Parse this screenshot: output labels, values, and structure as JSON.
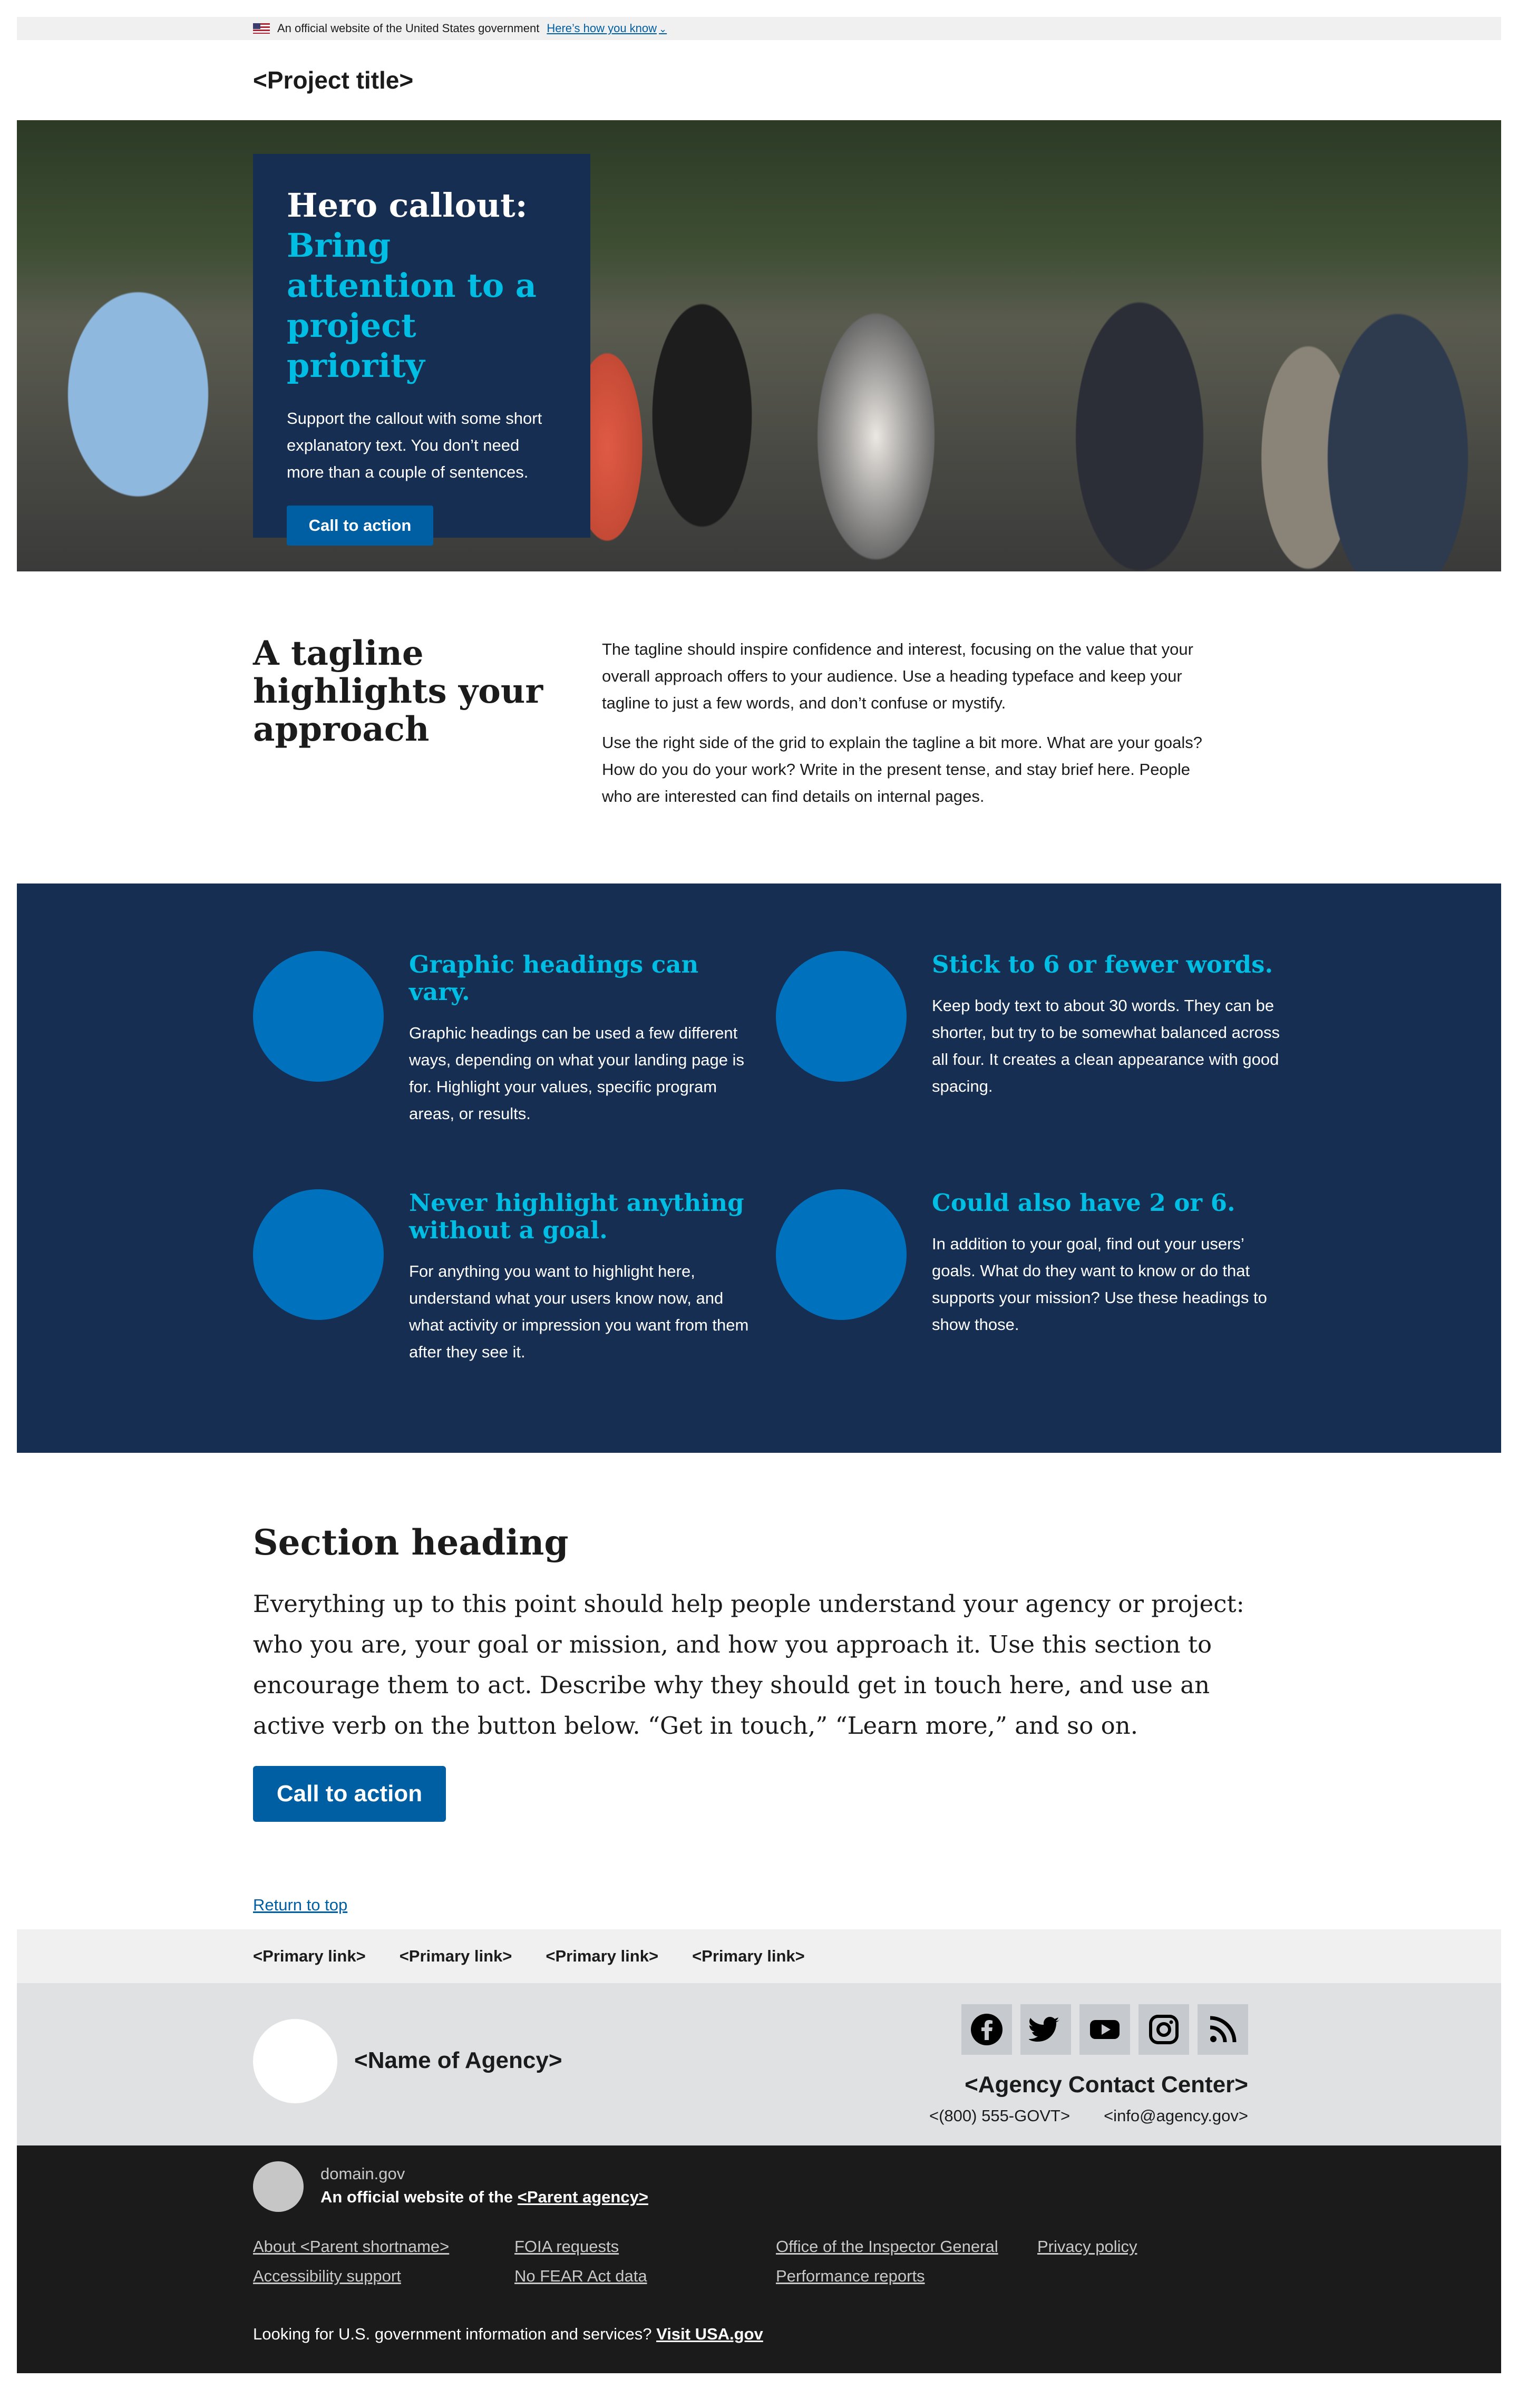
{
  "banner": {
    "official_text": "An official website of the United States government",
    "how_you_know": "Here’s how you know"
  },
  "header": {
    "project_title": "<Project title>"
  },
  "hero": {
    "title": "Hero callout:",
    "title_accent": "Bring attention to a project priority",
    "text": "Support the callout with some short explanatory text. You don’t need more than a couple of sentences.",
    "button": "Call to action"
  },
  "tagline": {
    "heading": "A tagline highlights your approach",
    "paragraph1": "The tagline should inspire confidence and interest, focusing on the value that your overall approach offers to your audience. Use a heading typeface and keep your tagline to just a few words, and don’t confuse or mystify.",
    "paragraph2": "Use the right side of the grid to explain the tagline a bit more. What are your goals? How do you do your work? Write in the present tense, and stay brief here. People who are interested can find details on internal pages."
  },
  "graphics": [
    {
      "heading": "Graphic headings can vary.",
      "body": "Graphic headings can be used a few different ways, depending on what your landing page is for. Highlight your values, specific program areas, or results."
    },
    {
      "heading": "Stick to 6 or fewer words.",
      "body": "Keep body text to about 30 words. They can be shorter, but try to be somewhat balanced across all four. It creates a clean appearance with good spacing."
    },
    {
      "heading": "Never highlight anything without a goal.",
      "body": "For anything you want to highlight here, understand what your users know now, and what activity or impression you want from them after they see it."
    },
    {
      "heading": "Could also have 2 or 6.",
      "body": "In addition to your goal, find out your users’ goals. What do they want to know or do that supports your mission? Use these headings to show those."
    }
  ],
  "section": {
    "heading": "Section heading",
    "body": "Everything up to this point should help people understand your agency or project: who you are, your goal or mission, and how you approach it. Use this section to encourage them to act. Describe why they should get in touch here, and use an active verb on the button below. “Get in touch,” “Learn more,” and so on.",
    "button": "Call to action",
    "return_top": "Return to top"
  },
  "footer_nav": {
    "links": [
      "<Primary link>",
      "<Primary link>",
      "<Primary link>",
      "<Primary link>"
    ]
  },
  "footer": {
    "agency_name": "<Name of Agency>",
    "social": [
      "facebook-icon",
      "twitter-icon",
      "youtube-icon",
      "instagram-icon",
      "rss-icon"
    ],
    "contact_center": "<Agency Contact Center>",
    "phone": "<(800) 555-GOVT>",
    "email": "<info@agency.gov>"
  },
  "identifier": {
    "domain": "domain.gov",
    "official_prefix": "An official website of the",
    "parent_agency": "<Parent agency>",
    "links": [
      "About <Parent shortname>",
      "FOIA requests",
      "Office of the Inspector General",
      "Privacy policy",
      "Accessibility support",
      "No FEAR Act data",
      "Performance reports"
    ],
    "usa_prefix": "Looking for U.S. government information and services?",
    "usa_link": "Visit USA.gov"
  },
  "colors": {
    "primary": "#005ea2",
    "dark_blue": "#162e51",
    "accent_cyan": "#00bde3",
    "circle_blue": "#0071bc"
  }
}
